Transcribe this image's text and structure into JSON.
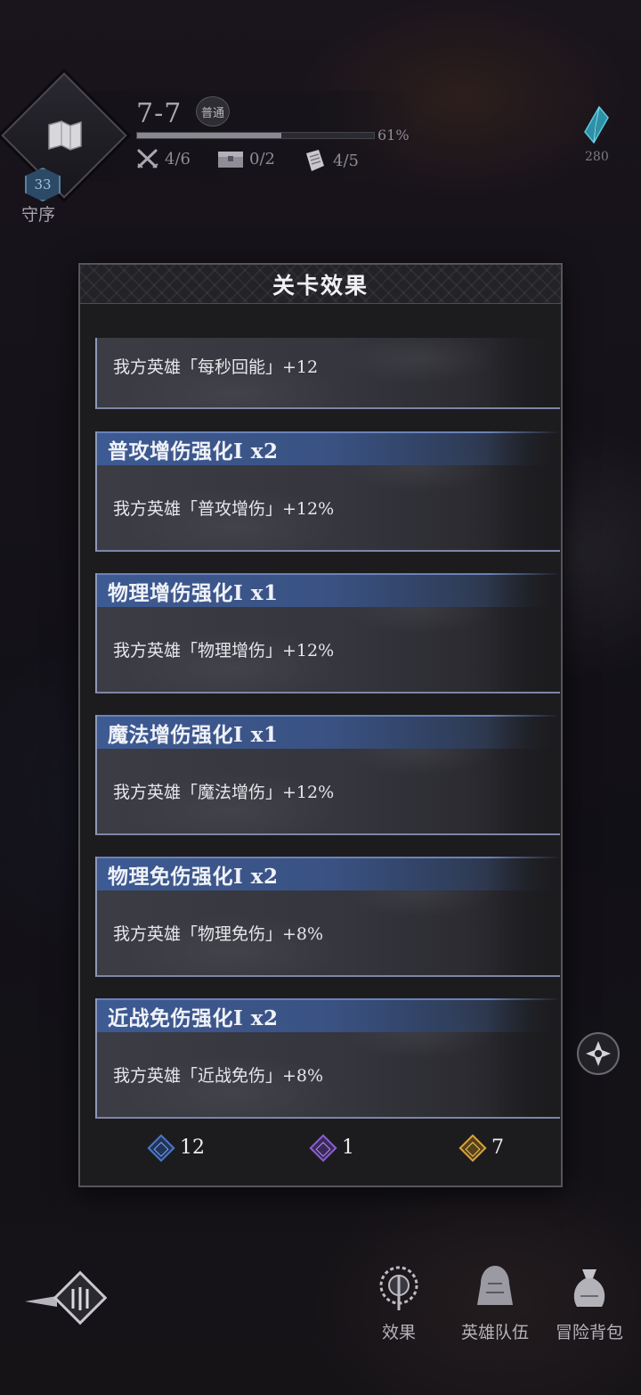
{
  "hud": {
    "level": "7-7",
    "difficulty_badge": "普通",
    "progress_percent": 61,
    "progress_text": "61%",
    "stats": [
      {
        "icon": "crossed-swords-icon",
        "value": "4/6"
      },
      {
        "icon": "chest-icon",
        "value": "0/2"
      },
      {
        "icon": "scroll-icon",
        "value": "4/5"
      }
    ],
    "rank_number": "33",
    "rank_label": "守序",
    "crystal_count": "280"
  },
  "modal": {
    "title": "关卡效果",
    "effects": [
      {
        "title": "",
        "desc": "我方英雄「每秒回能」+12"
      },
      {
        "title": "普攻增伤强化Ⅰ x2",
        "desc": "我方英雄「普攻增伤」+12%"
      },
      {
        "title": "物理增伤强化Ⅰ x1",
        "desc": "我方英雄「物理增伤」+12%"
      },
      {
        "title": "魔法增伤强化Ⅰ x1",
        "desc": "我方英雄「魔法增伤」+12%"
      },
      {
        "title": "物理免伤强化Ⅰ x2",
        "desc": "我方英雄「物理免伤」+8%"
      },
      {
        "title": "近战免伤强化Ⅰ x2",
        "desc": "我方英雄「近战免伤」+8%"
      }
    ],
    "currencies": [
      {
        "name": "blue-gem",
        "color": "#4a78c8",
        "value": "12"
      },
      {
        "name": "purple-gem",
        "color": "#8a5ed0",
        "value": "1"
      },
      {
        "name": "gold-gem",
        "color": "#d9a23a",
        "value": "7"
      }
    ]
  },
  "bottom_nav": {
    "items": [
      {
        "label": "效果",
        "icon": "effect-emblem-icon"
      },
      {
        "label": "英雄队伍",
        "icon": "hero-team-icon"
      },
      {
        "label": "冒险背包",
        "icon": "adventure-bag-icon"
      }
    ]
  }
}
